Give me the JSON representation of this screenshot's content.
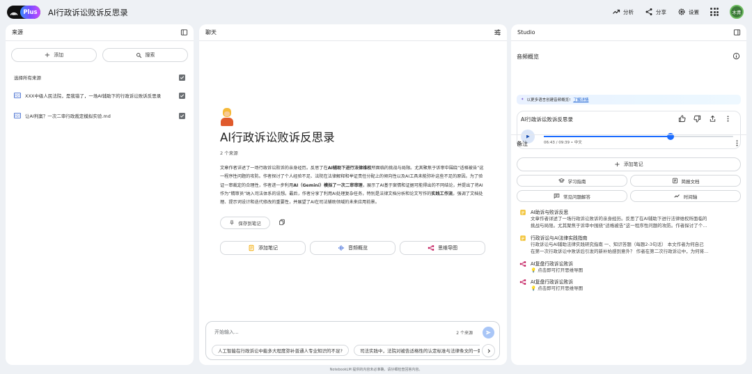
{
  "header": {
    "logo_plus": "Plus",
    "title": "AI行政诉讼败诉反思录",
    "analyze": "分析",
    "share": "分享",
    "settings": "设置",
    "avatar_text": "木青"
  },
  "sources": {
    "title": "来源",
    "add_label": "添加",
    "search_label": "搜索",
    "select_all": "选择所有来源",
    "items": [
      {
        "icon": "PDF",
        "label": "XXX中级人民法院，是我错了，一场AI辅助下的行政诉讼败诉反思录"
      },
      {
        "icon": "PDF",
        "label": "让AI判案？一次二审行政裁定模拟实验.md"
      }
    ]
  },
  "chat": {
    "title": "聊天",
    "doc_title": "AI行政诉讼败诉反思录",
    "source_count": "2 个来源",
    "summary_parts": [
      {
        "t": "文章作者详述了一场行政诉讼败诉的亲身经历。反思了在",
        "b": false
      },
      {
        "t": "AI辅助下进行法律维权",
        "b": true
      },
      {
        "t": "所面临的挑战与局限。尤其聚焦于诉审中围绕“适格被告”这一程序性问题的攻防。作者探讨了个人经验不足、法院在法律解释和举证责任分配上的倾向性以及AI工具未能弥补这些不足的原因。为了验证一审裁定的合理性，作者进一步利用",
        "b": false
      },
      {
        "t": "AI（Gemini）模拟了一次二审审理",
        "b": true
      },
      {
        "t": "，展示了AI基于案情和证据可能得出的不同结论，并提出了将AI作为“精审员”纳入司法体系的设想。最后，作者分享了利用AI处理复杂任务，特别是法律文档分析和论文写作的",
        "b": false
      },
      {
        "t": "实践工作流",
        "b": true
      },
      {
        "t": "，强调了文档处理、提示词设计和迭代修改的重要性，并展望了AI在司法辅助领域的未来应用前景。",
        "b": false
      }
    ],
    "save_note": "保存到笔记",
    "grid": [
      "添加笔记",
      "音频概览",
      "思维导图"
    ],
    "input_placeholder": "开始输入...",
    "input_count": "2 个来源",
    "suggestions": [
      "人工智能在行政诉讼中能多大程度弥补普通人专业知识的不足?",
      "司法实践中，法院对被告适格性的认定标准与法律条文的一致性如何?"
    ]
  },
  "studio": {
    "title": "Studio",
    "audio_overview": "音频概览",
    "banner_text": "以更多语言创建音频概览!",
    "banner_link": "了解详情",
    "audio_title": "AI行政诉讼败诉反思录",
    "audio_progress": 0.67,
    "audio_time": "06:43 / 09:39 • 中文",
    "notes_title": "备注",
    "add_note": "添加笔记",
    "note_buttons": [
      "学习指南",
      "简报文档",
      "常见问题解答",
      "时间轴"
    ],
    "notes": [
      {
        "title": "AI助诉与败诉反思",
        "desc1": "文章作者详述了一场行政诉讼败诉的亲身经历。反思了在AI辅助下进行法律维权所面临的",
        "desc2": "挑战与局限。尤其聚焦于诉审中围绕“适格被告”这一程序性问题的攻防。作者探讨了个...",
        "type": "note"
      },
      {
        "title": "行政诉讼与AI法律实践指南",
        "desc1": "行政诉讼与AI辅助法律实践研究指南 一、知识答题（每题2-3句话） 本文作者为何自己",
        "desc2": "在第一次行政诉讼中败诉后引发的新补始感到意外？ 作者在第二次行政诉讼中，为何将...",
        "type": "note"
      },
      {
        "title": "AI复盘行政诉讼败诉",
        "desc1": "点击即可打开思维导图",
        "type": "mindmap"
      },
      {
        "title": "AI复盘行政诉讼败诉",
        "desc1": "点击即可打开思维导图",
        "type": "mindmap"
      }
    ]
  },
  "footer": "NotebookLM 提供的内容未必准确，请仔细检查回答内容。"
}
